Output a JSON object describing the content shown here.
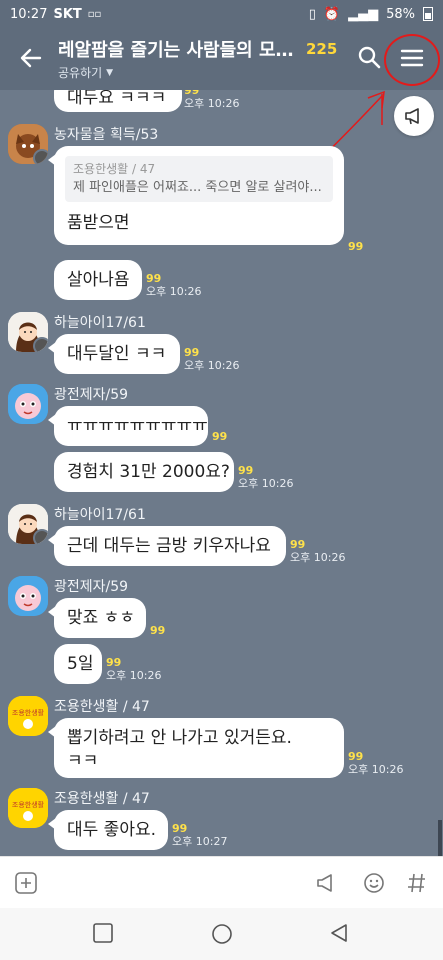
{
  "status_bar": {
    "time": "10:27",
    "carrier": "SKT",
    "extra": "▫▫",
    "battery": "58%"
  },
  "header": {
    "title": "레알팜을 즐기는 사람들의 모임...",
    "member_count": "225",
    "share_label": "공유하기"
  },
  "colors": {
    "header_bg": "#5f6c7c",
    "chat_bg": "#6d7a8a",
    "unread_count": "#ffe24a",
    "annotation_red": "#e21b1b"
  },
  "messages": {
    "m0": {
      "text": "대두요 ㅋㅋㅋ",
      "unread": "99",
      "time": "오후 10:26"
    },
    "m1": {
      "sender": "농자물을 획득/53",
      "quote_name": "조용한생활 / 47",
      "quote_text": "제 파인애플은 어쩌죠... 죽으면 알로 살려야...",
      "text": "품받으면",
      "unread": "99"
    },
    "m2": {
      "text": "살아나욤",
      "unread": "99",
      "time": "오후 10:26"
    },
    "m3": {
      "sender": "하늘아이17/61",
      "text": "대두달인 ㅋㅋ",
      "unread": "99",
      "time": "오후 10:26"
    },
    "m4": {
      "sender": "광전제자/59",
      "text": "ㅠㅠㅠㅠㅠㅠㅠㅠㅠ",
      "unread": "99"
    },
    "m5": {
      "text": "경험치 31만 2000요?",
      "unread": "99",
      "time": "오후 10:26"
    },
    "m6": {
      "sender": "하늘아이17/61",
      "text": "근데 대두는 금방 키우자나요",
      "unread": "99",
      "time": "오후 10:26"
    },
    "m7": {
      "sender": "광전제자/59",
      "text": "맞죠 ㅎㅎ",
      "unread": "99"
    },
    "m8": {
      "text": "5일",
      "unread": "99",
      "time": "오후 10:26"
    },
    "m9": {
      "sender": "조용한생활 / 47",
      "text1": "뽑기하려고 안 나가고 있거든요.",
      "text2": "ㅋㅋ",
      "unread": "99",
      "time": "오후 10:26"
    },
    "m10": {
      "sender": "조용한생활 / 47",
      "text": "대두 좋아요.",
      "unread": "99",
      "time": "오후 10:27"
    }
  },
  "avatar_labels": {
    "quiet_life": "조용한생활"
  },
  "icons": {
    "back": "arrow-left-icon",
    "search": "search-icon",
    "menu": "hamburger-menu-icon",
    "notice": "megaphone-icon",
    "plus": "plus-box-icon",
    "announce": "megaphone-outline-icon",
    "emoji": "emoji-icon",
    "hash": "hash-icon",
    "nav_recent": "square-icon",
    "nav_home": "circle-icon",
    "nav_back": "triangle-back-icon"
  }
}
